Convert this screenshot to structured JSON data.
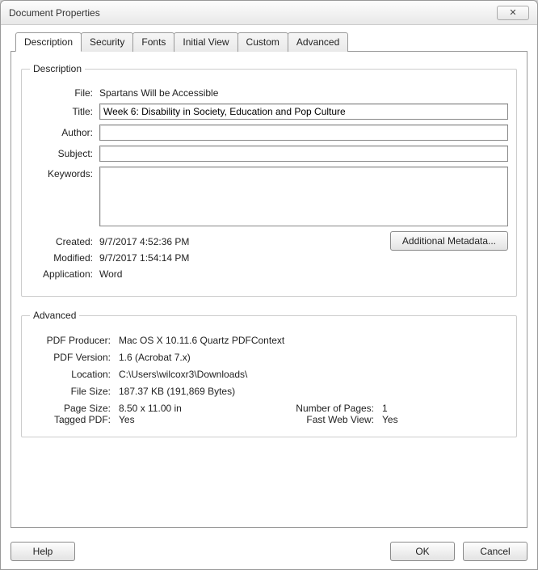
{
  "window": {
    "title": "Document Properties",
    "close_glyph": "✕"
  },
  "tabs": {
    "description": "Description",
    "security": "Security",
    "fonts": "Fonts",
    "initial_view": "Initial View",
    "custom": "Custom",
    "advanced": "Advanced"
  },
  "description_group": {
    "legend": "Description",
    "labels": {
      "file": "File:",
      "title": "Title:",
      "author": "Author:",
      "subject": "Subject:",
      "keywords": "Keywords:",
      "created": "Created:",
      "modified": "Modified:",
      "application": "Application:"
    },
    "values": {
      "file": "Spartans Will be Accessible",
      "title": "Week 6: Disability in Society, Education and Pop Culture",
      "author": "",
      "subject": "",
      "keywords": "",
      "created": "9/7/2017 4:52:36 PM",
      "modified": "9/7/2017 1:54:14 PM",
      "application": "Word"
    },
    "additional_metadata_btn": "Additional Metadata..."
  },
  "advanced_group": {
    "legend": "Advanced",
    "labels": {
      "pdf_producer": "PDF Producer:",
      "pdf_version": "PDF Version:",
      "location": "Location:",
      "file_size": "File Size:",
      "page_size": "Page Size:",
      "number_of_pages": "Number of Pages:",
      "tagged_pdf": "Tagged PDF:",
      "fast_web_view": "Fast Web View:"
    },
    "values": {
      "pdf_producer": "Mac OS X 10.11.6 Quartz PDFContext",
      "pdf_version": "1.6 (Acrobat 7.x)",
      "location": "C:\\Users\\wilcoxr3\\Downloads\\",
      "file_size": "187.37 KB (191,869 Bytes)",
      "page_size": "8.50 x 11.00 in",
      "number_of_pages": "1",
      "tagged_pdf": "Yes",
      "fast_web_view": "Yes"
    }
  },
  "footer": {
    "help": "Help",
    "ok": "OK",
    "cancel": "Cancel"
  }
}
